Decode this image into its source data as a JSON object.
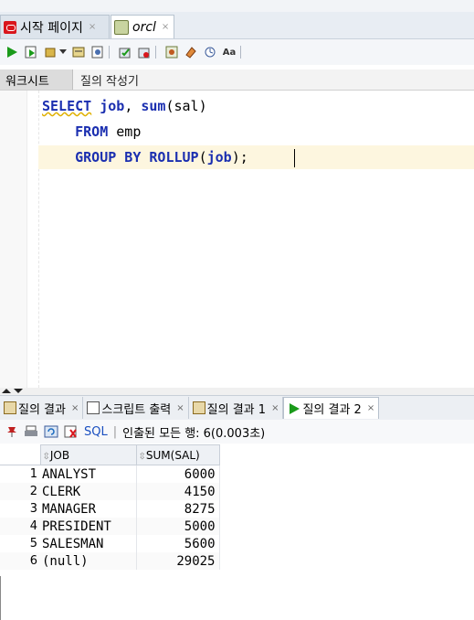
{
  "doc_tabs": [
    {
      "label": "시작 페이지",
      "close": "×"
    },
    {
      "label": "orcl",
      "close": "×"
    }
  ],
  "worksheet_tabs": [
    "워크시트",
    "질의 작성기"
  ],
  "editor": {
    "line1": {
      "kw1": "SELECT",
      "rest1": " ",
      "kw2": "job",
      "rest2": ", ",
      "kw3": "sum",
      "rest3": "(sal)"
    },
    "line2": {
      "indent": "    ",
      "kw": "FROM",
      "rest": " emp"
    },
    "line3": {
      "indent": "    ",
      "kw1": "GROUP BY",
      "rest1": " ",
      "kw2": "ROLLUP",
      "rest2": "(",
      "kw3": "job",
      "rest3": ");"
    }
  },
  "result_tabs": [
    {
      "label": "질의 결과",
      "close": "×"
    },
    {
      "label": "스크립트 출력",
      "close": "×"
    },
    {
      "label": "질의 결과 1",
      "close": "×"
    },
    {
      "label": "질의 결과 2",
      "close": "×"
    }
  ],
  "result_toolbar": {
    "sql_label": "SQL",
    "status": "인출된 모든 행: 6(0.003초)"
  },
  "grid": {
    "columns": [
      "JOB",
      "SUM(SAL)"
    ],
    "rows": [
      {
        "n": "1",
        "job": "ANALYST",
        "sum": "6000"
      },
      {
        "n": "2",
        "job": "CLERK",
        "sum": "4150"
      },
      {
        "n": "3",
        "job": "MANAGER",
        "sum": "8275"
      },
      {
        "n": "4",
        "job": "PRESIDENT",
        "sum": "5000"
      },
      {
        "n": "5",
        "job": "SALESMAN",
        "sum": "5600"
      },
      {
        "n": "6",
        "job": "(null)",
        "sum": "29025"
      }
    ]
  },
  "colors": {
    "keyword": "#1b2fb0",
    "current_line": "#fdf6df",
    "run_green": "#1a9a1a"
  }
}
